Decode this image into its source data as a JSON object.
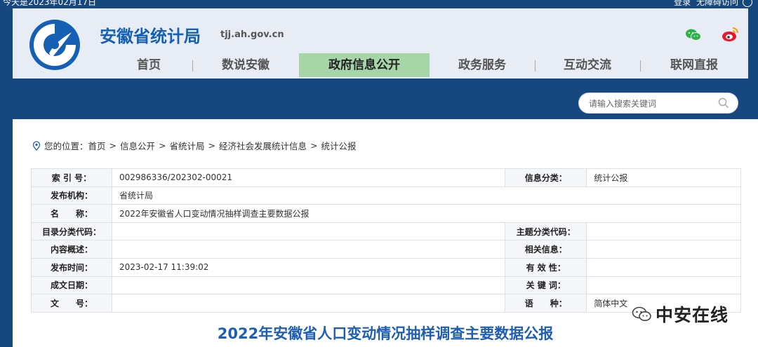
{
  "topbar": {
    "date": "今天是2023年02月17日",
    "login": "登录",
    "barrier_free": "无障碍访问"
  },
  "header": {
    "site_title": "安徽省统计局",
    "site_domain": "tjj.ah.gov.cn",
    "brand_color": "#1560b5",
    "icons": [
      "wechat-icon",
      "weibo-icon"
    ]
  },
  "nav": {
    "items": [
      {
        "label": "首页"
      },
      {
        "label": "数说安徽"
      },
      {
        "label": "政府信息公开",
        "active": true
      },
      {
        "label": "政务服务"
      },
      {
        "label": "互动交流"
      },
      {
        "label": "联网直报"
      }
    ],
    "active_color": "#a6d5a8"
  },
  "search": {
    "placeholder": "请输入搜索关键词"
  },
  "breadcrumb": {
    "prefix": "您的位置：",
    "items": [
      "首页",
      "信息公开",
      "省统计局",
      "经济社会发展统计信息",
      "统计公报"
    ],
    "separator": ">"
  },
  "meta_table": {
    "rows": [
      {
        "k1": "索 引 号：",
        "v1": "002986336/202302-00021",
        "k2": "信息分类：",
        "v2": "统计公报"
      },
      {
        "k1": "发布机构：",
        "v1": "省统计局"
      },
      {
        "k1": "名　　称：",
        "v1": "2022年安徽省人口变动情况抽样调查主要数据公报"
      },
      {
        "k1": "目录分类代码：",
        "v1": "",
        "k2": "主题分类代码：",
        "v2": ""
      },
      {
        "k1": "内容概述：",
        "v1": "",
        "k2": "相关信息：",
        "v2": ""
      },
      {
        "k1": "发布时间：",
        "v1": "2023-02-17 11:39:02",
        "k2": "有 效 性：",
        "v2": ""
      },
      {
        "k1": "成文日期：",
        "v1": "",
        "k2": "关 键 词：",
        "v2": ""
      },
      {
        "k1": "文　　号：",
        "v1": "",
        "k2": "语　　种：",
        "v2": "简体中文"
      }
    ]
  },
  "document": {
    "title": "2022年安徽省人口变动情况抽样调查主要数据公报",
    "title_color": "#1e5fb3"
  },
  "watermark": {
    "text": "中安在线"
  }
}
